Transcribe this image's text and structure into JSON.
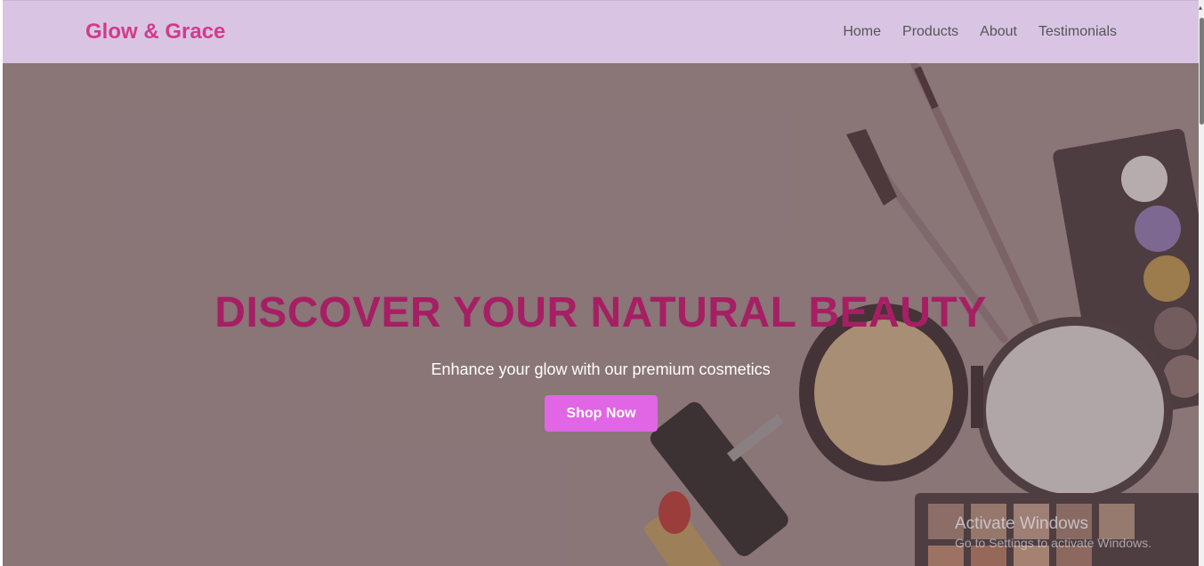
{
  "brand": {
    "name": "Glow & Grace"
  },
  "nav": {
    "items": [
      {
        "label": "Home"
      },
      {
        "label": "Products"
      },
      {
        "label": "About"
      },
      {
        "label": "Testimonials"
      }
    ]
  },
  "hero": {
    "title": "DISCOVER YOUR NATURAL BEAUTY",
    "subtitle": "Enhance your glow with our premium cosmetics",
    "cta_label": "Shop Now"
  },
  "watermark": {
    "title": "Activate Windows",
    "subtitle": "Go to Settings to activate Windows."
  },
  "colors": {
    "navbar_bg": "#d9c5e3",
    "brand": "#d33a8c",
    "hero_title": "#a61f64",
    "cta_bg": "#e066e6"
  }
}
